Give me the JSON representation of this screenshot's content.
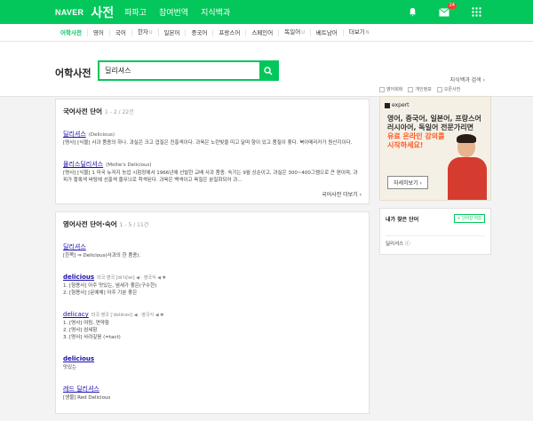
{
  "topbar": {
    "logo": "NAVER",
    "brand": "사전",
    "nav": [
      "파파고",
      "참여번역",
      "지식백과"
    ],
    "mail_badge": "24"
  },
  "subnav": [
    {
      "label": "어학사전",
      "active": true
    },
    {
      "label": "영어"
    },
    {
      "label": "국어"
    },
    {
      "label": "한자",
      "suffix": "U"
    },
    {
      "label": "일본어"
    },
    {
      "label": "중국어"
    },
    {
      "label": "프랑스어"
    },
    {
      "label": "스페인어"
    },
    {
      "label": "독일어",
      "suffix": "U"
    },
    {
      "label": "베트남어"
    },
    {
      "label": "더보기",
      "suffix": "N"
    }
  ],
  "header": {
    "title": "어학사전",
    "search_value": "딜리셔스",
    "right_link": "지식백과 검색 ›"
  },
  "korean_section": {
    "title": "국어사전 단어",
    "count": "1 - 2 / 22건",
    "entries": [
      {
        "title": "딜리셔스",
        "orig": "(Delicious)",
        "def": "[명사] [식물] 사과 품종의 하나. 과실은 크고 겹질은 진홍색이다. 과육은 노란빛을 띠고 달며 향이 있고 품질이 좋다. 북아메리카가 원산지이다."
      },
      {
        "title": "몰리스딜리셔스",
        "orig": "(Mollie's Delicious)",
        "def": "[명사] [식물] 1 미국 뉴저지 농업 시험장에서 1966년에 선발한 교배 사과 품종. 숙기는 9월 상순이고, 과실은 300~400그램으로 큰 편이며, 과피가 황록색 바탕에 선홍색 줄무늬로 착색된다. 과육은 백색이고 육질은 분질화되어 과..."
      }
    ],
    "more": "국어사전 더보기 ›"
  },
  "english_section": {
    "title": "영어사전 단어·숙어",
    "count": "1 - 5 / 11건",
    "entries": [
      {
        "title": "딜리셔스",
        "bold": false,
        "lines": [
          "[한쪽] ⇒ Delicious(사과의 한 품종)."
        ]
      },
      {
        "title": "delicious",
        "bold": true,
        "pron": "미국·영국 [dɪˈlɪʃəs] ◀ · 영국식 ◀ ✱",
        "lines": [
          "1. [형용사] 아주 맛있는, 냄새가 좋은(구수한)",
          "2. [형용사] [문예체] 아주 기분 좋은"
        ]
      },
      {
        "title": "delicacy",
        "bold": false,
        "pron": "미국·영국 [ˈdelɪkəsi] ◀ · 영국식 ◀ ✱",
        "lines": [
          "1. [명사] 여림, 연약함",
          "2. [명사] 섬세함",
          "3. [명사] 사려깊음 (=tact)"
        ]
      },
      {
        "title": "delicious",
        "bold": true,
        "lines": [
          "맛있는"
        ]
      },
      {
        "title": "레드 딜리셔스",
        "bold": false,
        "lines": [
          "[생물] Red Delicious"
        ]
      }
    ]
  },
  "side": {
    "tabs": [
      "영어회화",
      "개인정보",
      "오픈사전"
    ],
    "ad": {
      "brand": "expert",
      "line1": "영어, 중국어, 일본어, 프랑스어",
      "line2": "러시아어, 독일어 전문가리면",
      "line3": "유료 온라인 강의를",
      "line4": "시작하세요!",
      "button": "자세히보기 ›"
    },
    "myword": {
      "title": "내가 찾은 단어",
      "button": "+ 단어장 저장",
      "item": "딜리셔스 ⓘ"
    }
  },
  "colors": {
    "brand": "#03c75a",
    "link": "#1a0dab",
    "ad_highlight": "#ff5a1f"
  }
}
